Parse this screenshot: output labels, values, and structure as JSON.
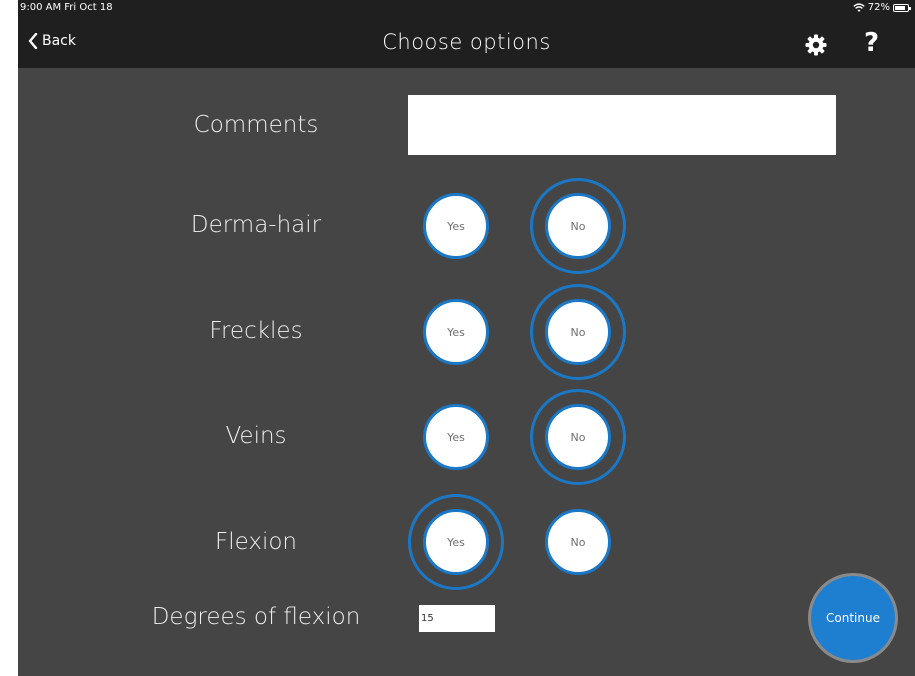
{
  "status_bar": {
    "time": "9:00 AM  Fri Oct 18",
    "battery": "72%",
    "wifi_icon": "wifi-icon",
    "battery_icon": "battery-icon"
  },
  "nav": {
    "back_label": "Back",
    "back_icon": "chevron-left-icon",
    "title": "Choose options",
    "settings_icon": "gear-icon",
    "help_label": "?"
  },
  "form": {
    "comments": {
      "label": "Comments",
      "value": ""
    },
    "options": [
      {
        "label": "Derma-hair",
        "yes": "Yes",
        "no": "No",
        "selected": "No"
      },
      {
        "label": "Freckles",
        "yes": "Yes",
        "no": "No",
        "selected": "No"
      },
      {
        "label": "Veins",
        "yes": "Yes",
        "no": "No",
        "selected": "No"
      },
      {
        "label": "Flexion",
        "yes": "Yes",
        "no": "No",
        "selected": "Yes"
      }
    ],
    "degrees": {
      "label": "Degrees of flexion",
      "value": "15"
    }
  },
  "continue_label": "Continue",
  "colors": {
    "background": "#454545",
    "bar": "#1f1f1f",
    "accent": "#1b78c6",
    "continue": "#1e7fd0"
  }
}
